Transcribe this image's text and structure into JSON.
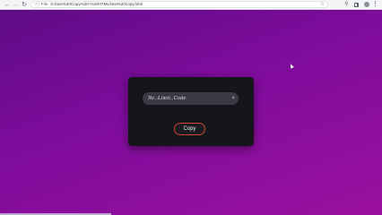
{
  "browser": {
    "nav": {
      "back_icon": "←",
      "forward_icon": "→",
      "reload_icon": "↻"
    },
    "address_bar": {
      "info_icon": "ⓘ",
      "scheme_label": "File",
      "url": "D:/text%20Copy%20-%20HTML/text%20copy.html",
      "bookmark_icon": "☆"
    },
    "toolbar": {
      "extensions_icon": "⚲",
      "menu_icon": "⋮"
    }
  },
  "card": {
    "input_value": "Ne..Limit..Code",
    "clear_icon": "×",
    "copy_label": "Copy"
  },
  "colors": {
    "background_start": "#5e0c86",
    "background_end": "#9b119e",
    "card": "#15151c",
    "field": "#3a3a44",
    "button_border": "#d3462e"
  }
}
